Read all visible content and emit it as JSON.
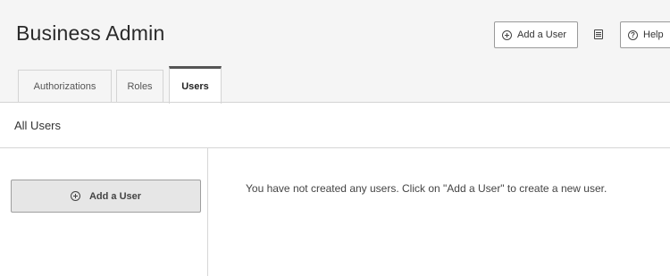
{
  "header": {
    "title": "Business Admin",
    "add_user_label": "Add a User",
    "help_label": "Help"
  },
  "tabs": [
    {
      "label": "Authorizations",
      "active": false
    },
    {
      "label": "Roles",
      "active": false
    },
    {
      "label": "Users",
      "active": true
    }
  ],
  "section": {
    "title": "All Users"
  },
  "sidebar": {
    "add_user_label": "Add a User"
  },
  "main": {
    "empty_message": "You have not created any users. Click on \"Add a User\" to create a new user."
  },
  "icons": {
    "add": "plus-circle-icon",
    "docs": "document-icon",
    "help": "question-circle-icon"
  }
}
